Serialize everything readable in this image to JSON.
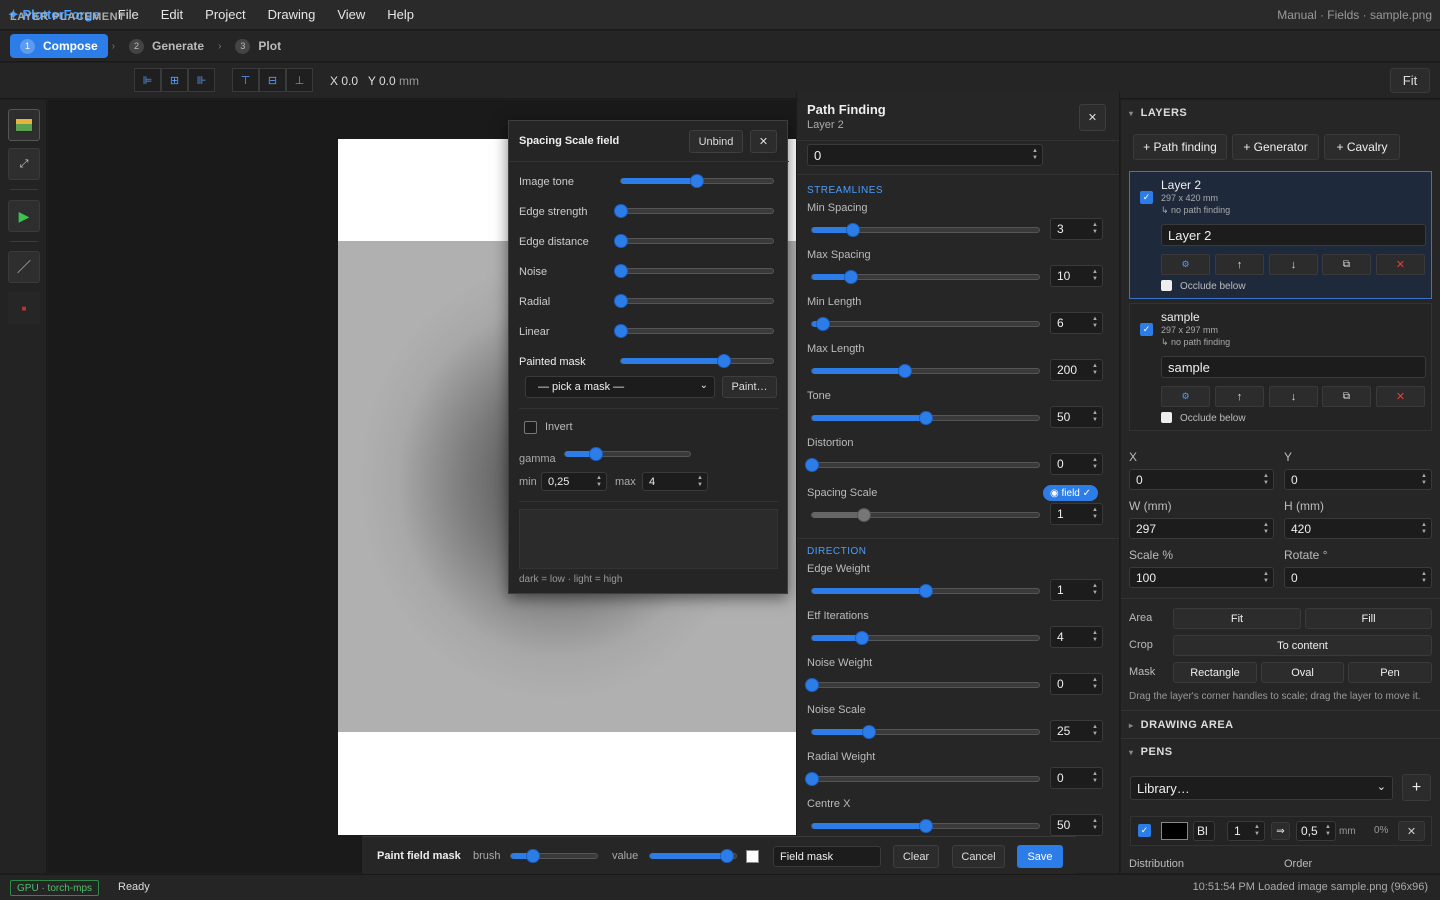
{
  "app": {
    "brand": "✦ PlotterForge",
    "menus": [
      "File",
      "Edit",
      "Project",
      "Drawing",
      "View",
      "Help"
    ],
    "title_right": "Manual · Fields · sample.png"
  },
  "steps": [
    {
      "num": "1",
      "label": "Compose"
    },
    {
      "num": "2",
      "label": "Generate"
    },
    {
      "num": "3",
      "label": "Plot"
    }
  ],
  "placement": {
    "label": "LAYER PLACEMENT",
    "x": "X 0.0",
    "y": "Y 0.0",
    "unit": "mm",
    "fit": "Fit"
  },
  "spacing_modal": {
    "title": "Spacing Scale field",
    "unbind": "Unbind",
    "close": "✕",
    "sliders": [
      {
        "label": "Image tone",
        "value": 0.5
      },
      {
        "label": "Edge strength",
        "value": 0
      },
      {
        "label": "Edge distance",
        "value": 0
      },
      {
        "label": "Noise",
        "value": 0
      },
      {
        "label": "Radial",
        "value": 0
      },
      {
        "label": "Linear",
        "value": 0
      },
      {
        "label": "Painted mask",
        "value": 0.68
      }
    ],
    "mask_select": "— pick a mask —",
    "paint": "Paint…",
    "invert": "Invert",
    "gamma": "gamma",
    "gamma_value": 0.25,
    "min_label": "min",
    "min": "0,25",
    "max_label": "max",
    "max": "4",
    "hint": "dark = low · light = high"
  },
  "pathfinding": {
    "title": "Path Finding",
    "subtitle": "Layer 2",
    "close": "✕",
    "seed": "0",
    "streamlines_title": "STREAMLINES",
    "streamlines": [
      {
        "label": "Min Spacing",
        "value": "3",
        "pos": 0.18
      },
      {
        "label": "Max Spacing",
        "value": "10",
        "pos": 0.17
      },
      {
        "label": "Min Length",
        "value": "6",
        "pos": 0.05
      },
      {
        "label": "Max Length",
        "value": "200",
        "pos": 0.41
      },
      {
        "label": "Tone",
        "value": "50",
        "pos": 0.5
      },
      {
        "label": "Distortion",
        "value": "0",
        "pos": 0.0
      },
      {
        "label": "Spacing Scale",
        "value": "1",
        "pos": 0.23
      }
    ],
    "field_badge": "◉ field ✓",
    "direction_title": "DIRECTION",
    "direction": [
      {
        "label": "Edge Weight",
        "value": "1",
        "pos": 0.5
      },
      {
        "label": "Etf Iterations",
        "value": "4",
        "pos": 0.22
      },
      {
        "label": "Noise Weight",
        "value": "0",
        "pos": 0.0
      },
      {
        "label": "Noise Scale",
        "value": "25",
        "pos": 0.25
      },
      {
        "label": "Radial Weight",
        "value": "0",
        "pos": 0.0
      },
      {
        "label": "Centre X",
        "value": "50",
        "pos": 0.5
      }
    ]
  },
  "paintbar": {
    "title": "Paint field mask",
    "brush": "brush",
    "brush_value": 0.25,
    "value": "value",
    "value_value": 0.9,
    "name": "Field mask",
    "clear": "Clear",
    "cancel": "Cancel",
    "save": "Save"
  },
  "layers": {
    "title": "LAYERS",
    "add": [
      "+ Path finding",
      "+ Generator",
      "+ Cavalry"
    ],
    "items": [
      {
        "name": "Layer 2",
        "size": "297 x 420 mm",
        "note": "↳ no path finding",
        "field": "Layer 2",
        "occlude": "Occlude below"
      },
      {
        "name": "sample",
        "size": "297 x 297 mm",
        "note": "↳ no path finding",
        "field": "sample",
        "occlude": "Occlude below"
      }
    ]
  },
  "transform": {
    "x_label": "X",
    "x": "0",
    "y_label": "Y",
    "y": "0",
    "w_label": "W (mm)",
    "w": "297",
    "h_label": "H (mm)",
    "h": "420",
    "scale_label": "Scale %",
    "scale": "100",
    "rotate_label": "Rotate °",
    "rotate": "0"
  },
  "area": {
    "label": "Area",
    "fit": "Fit",
    "fill": "Fill",
    "crop_label": "Crop",
    "crop": "To content",
    "mask_label": "Mask",
    "rect": "Rectangle",
    "oval": "Oval",
    "pen": "Pen",
    "hint": "Drag the layer's corner handles to scale; drag the layer to move it."
  },
  "drawing_area": "DRAWING AREA",
  "pens": {
    "title": "PENS",
    "library": "Library…",
    "add": "+",
    "pen_name": "Bl",
    "pen_num": "1",
    "width": "0,5",
    "unit": "mm",
    "pct": "0%",
    "remove": "✕",
    "distribution": "Distribution",
    "order": "Order"
  },
  "status": {
    "gpu": "GPU · torch-mps",
    "state": "Ready",
    "log": "10:51:54 PM Loaded image sample.png (96x96)"
  }
}
